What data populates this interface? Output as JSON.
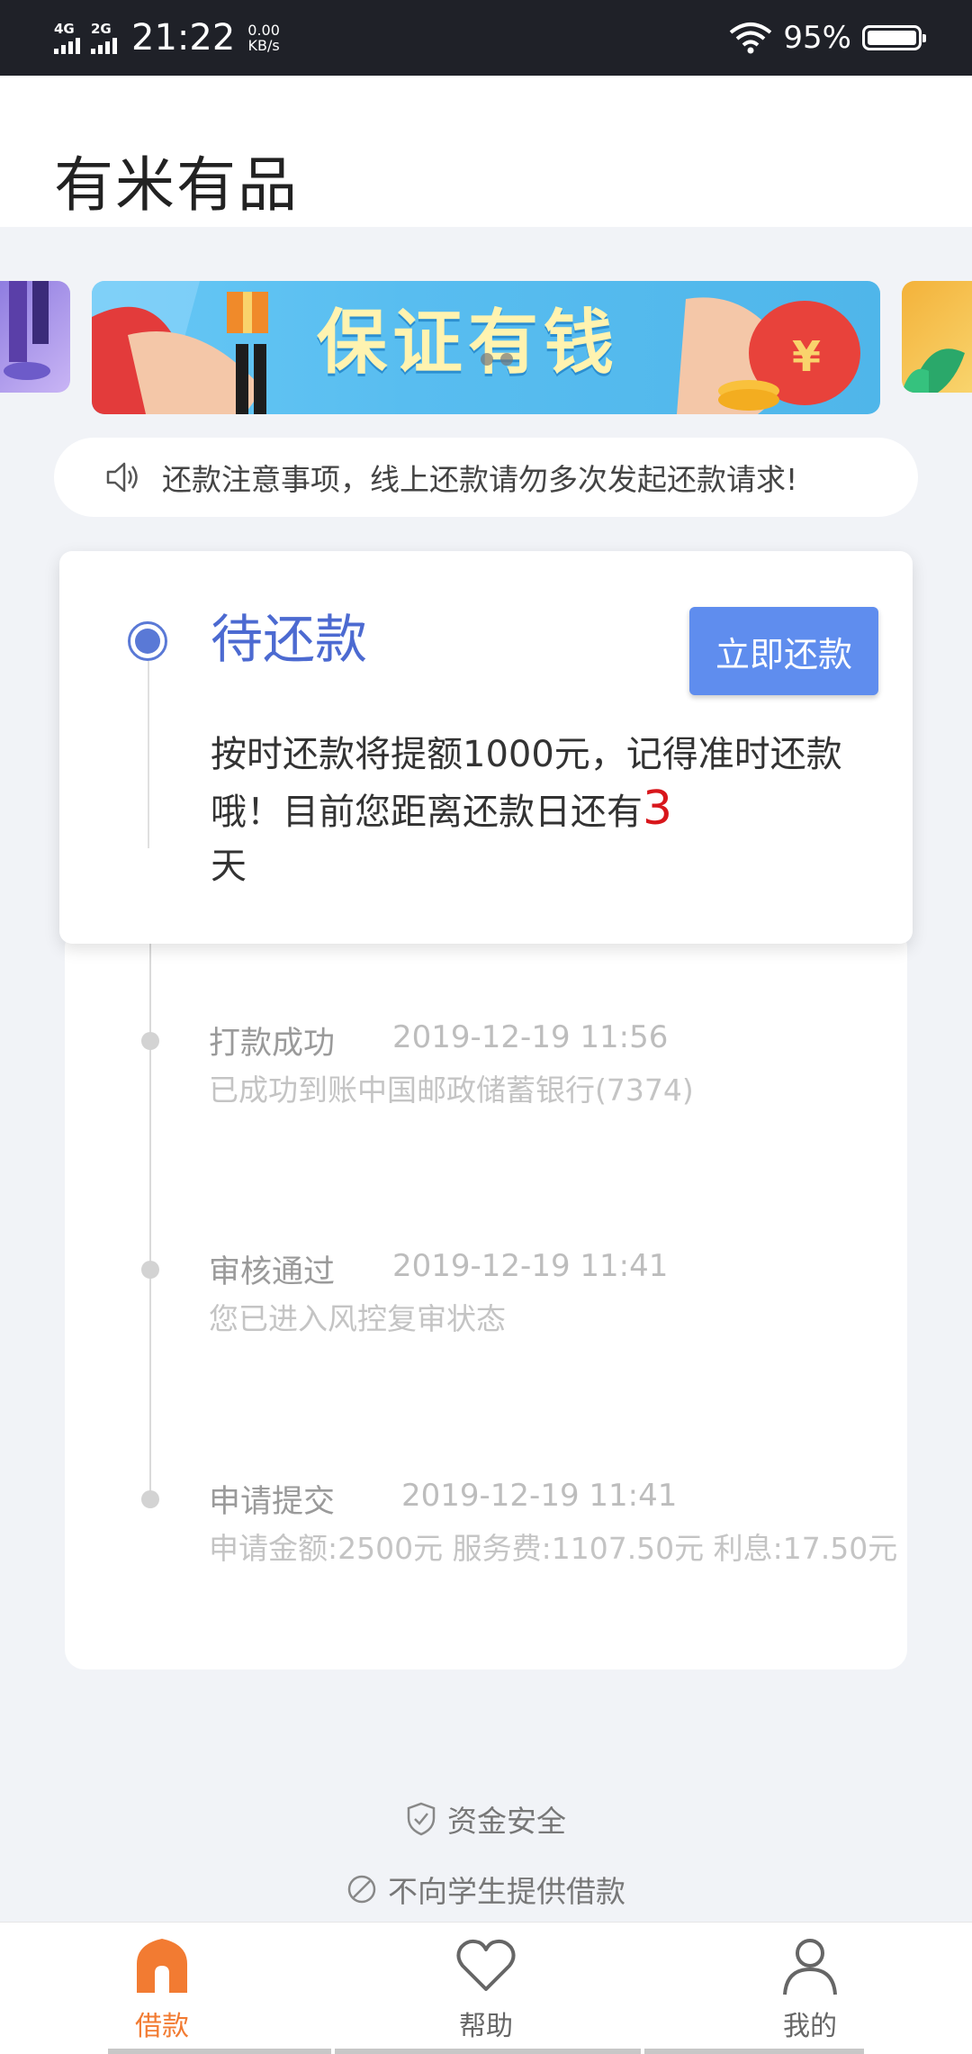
{
  "status_bar": {
    "signal_1": "4G",
    "signal_2": "2G",
    "time": "21:22",
    "net_speed_value": "0.00",
    "net_speed_unit": "KB/s",
    "battery": "95%"
  },
  "header": {
    "title": "有米有品"
  },
  "banner": {
    "text": "保证有钱",
    "slide_count": 3,
    "active_slide": 2
  },
  "notice": {
    "text": "还款注意事项，线上还款请勿多次发起还款请求!"
  },
  "current_status": {
    "title": "待还款",
    "button_label": "立即还款",
    "desc_before": "按时还款将提额1000元，记得准时还款哦！目前您距离还款日还有",
    "days": "3",
    "desc_after": "天"
  },
  "timeline": [
    {
      "title": "打款成功",
      "time": "2019-12-19 11:56",
      "desc": "已成功到账中国邮政储蓄银行(7374)"
    },
    {
      "title": "审核通过",
      "time": "2019-12-19 11:41",
      "desc": "您已进入风控复审状态"
    },
    {
      "title": "申请提交",
      "time": "2019-12-19 11:41",
      "desc": "申请金额:2500元  服务费:1107.50元 利息:17.50元"
    }
  ],
  "safety": [
    {
      "text": "资金安全",
      "icon": "shield-check-icon"
    },
    {
      "text": "不向学生提供借款",
      "icon": "prohibited-icon"
    }
  ],
  "tabs": [
    {
      "label": "借款",
      "icon": "home-icon",
      "active": true
    },
    {
      "label": "帮助",
      "icon": "heart-icon",
      "active": false
    },
    {
      "label": "我的",
      "icon": "user-icon",
      "active": false
    }
  ],
  "colors": {
    "accent": "#5a79d6",
    "button": "#5f8dee",
    "tab_active": "#f27b32",
    "highlight": "#d8161b"
  }
}
